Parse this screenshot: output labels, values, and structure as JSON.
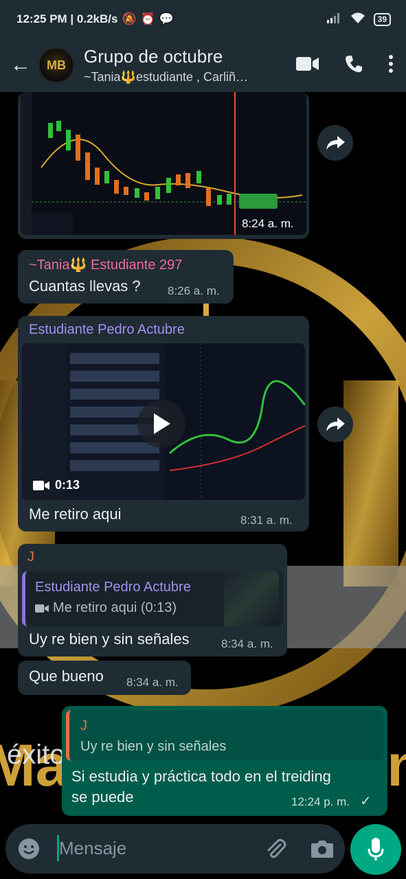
{
  "status_bar": {
    "time_speed": "12:25 PM | 0.2kB/s",
    "battery": "39"
  },
  "header": {
    "title": "Grupo de octubre",
    "subtitle": "~Tania🔱estudiante , Carliñ…",
    "avatar_text": "MB"
  },
  "messages": [
    {
      "type": "image",
      "time": "8:24 a. m."
    },
    {
      "sender": "~Tania🔱 Estudiante 297",
      "sender_color": "#f06a9b",
      "text": "Cuantas llevas ?",
      "time": "8:26 a. m."
    },
    {
      "sender": "Estudiante Pedro Actubre",
      "sender_color": "#a58ff0",
      "video_duration": "0:13",
      "text": "Me retiro aqui",
      "time": "8:31 a. m."
    },
    {
      "sender": "J",
      "sender_color": "#e86f47",
      "quote_sender": "Estudiante Pedro Actubre",
      "quote_text": "Me retiro aqui (0:13)",
      "text": "Uy re bien y sin señales",
      "time": "8:34 a. m."
    },
    {
      "text": "Que bueno",
      "time": "8:34 a. m."
    },
    {
      "outgoing": true,
      "quote_sender": "J",
      "quote_text": "Uy re bien y sin señales",
      "text_line1": "Si estudia y práctica todo en el treiding",
      "text_line2": "se puede",
      "time": "12:24 p. m."
    }
  ],
  "composer": {
    "placeholder": "Mensaje"
  }
}
